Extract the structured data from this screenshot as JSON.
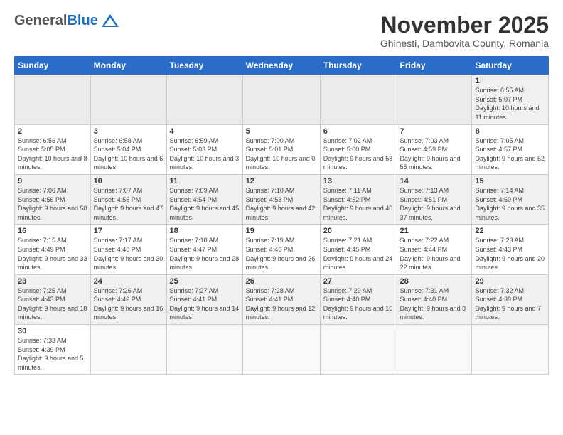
{
  "logo": {
    "general": "General",
    "blue": "Blue",
    "tagline": ""
  },
  "title": "November 2025",
  "subtitle": "Ghinesti, Dambovita County, Romania",
  "headers": [
    "Sunday",
    "Monday",
    "Tuesday",
    "Wednesday",
    "Thursday",
    "Friday",
    "Saturday"
  ],
  "weeks": [
    [
      {
        "day": "",
        "info": ""
      },
      {
        "day": "",
        "info": ""
      },
      {
        "day": "",
        "info": ""
      },
      {
        "day": "",
        "info": ""
      },
      {
        "day": "",
        "info": ""
      },
      {
        "day": "",
        "info": ""
      },
      {
        "day": "1",
        "info": "Sunrise: 6:55 AM\nSunset: 5:07 PM\nDaylight: 10 hours\nand 11 minutes."
      }
    ],
    [
      {
        "day": "2",
        "info": "Sunrise: 6:56 AM\nSunset: 5:05 PM\nDaylight: 10 hours\nand 8 minutes."
      },
      {
        "day": "3",
        "info": "Sunrise: 6:58 AM\nSunset: 5:04 PM\nDaylight: 10 hours\nand 6 minutes."
      },
      {
        "day": "4",
        "info": "Sunrise: 6:59 AM\nSunset: 5:03 PM\nDaylight: 10 hours\nand 3 minutes."
      },
      {
        "day": "5",
        "info": "Sunrise: 7:00 AM\nSunset: 5:01 PM\nDaylight: 10 hours\nand 0 minutes."
      },
      {
        "day": "6",
        "info": "Sunrise: 7:02 AM\nSunset: 5:00 PM\nDaylight: 9 hours\nand 58 minutes."
      },
      {
        "day": "7",
        "info": "Sunrise: 7:03 AM\nSunset: 4:59 PM\nDaylight: 9 hours\nand 55 minutes."
      },
      {
        "day": "8",
        "info": "Sunrise: 7:05 AM\nSunset: 4:57 PM\nDaylight: 9 hours\nand 52 minutes."
      }
    ],
    [
      {
        "day": "9",
        "info": "Sunrise: 7:06 AM\nSunset: 4:56 PM\nDaylight: 9 hours\nand 50 minutes."
      },
      {
        "day": "10",
        "info": "Sunrise: 7:07 AM\nSunset: 4:55 PM\nDaylight: 9 hours\nand 47 minutes."
      },
      {
        "day": "11",
        "info": "Sunrise: 7:09 AM\nSunset: 4:54 PM\nDaylight: 9 hours\nand 45 minutes."
      },
      {
        "day": "12",
        "info": "Sunrise: 7:10 AM\nSunset: 4:53 PM\nDaylight: 9 hours\nand 42 minutes."
      },
      {
        "day": "13",
        "info": "Sunrise: 7:11 AM\nSunset: 4:52 PM\nDaylight: 9 hours\nand 40 minutes."
      },
      {
        "day": "14",
        "info": "Sunrise: 7:13 AM\nSunset: 4:51 PM\nDaylight: 9 hours\nand 37 minutes."
      },
      {
        "day": "15",
        "info": "Sunrise: 7:14 AM\nSunset: 4:50 PM\nDaylight: 9 hours\nand 35 minutes."
      }
    ],
    [
      {
        "day": "16",
        "info": "Sunrise: 7:15 AM\nSunset: 4:49 PM\nDaylight: 9 hours\nand 33 minutes."
      },
      {
        "day": "17",
        "info": "Sunrise: 7:17 AM\nSunset: 4:48 PM\nDaylight: 9 hours\nand 30 minutes."
      },
      {
        "day": "18",
        "info": "Sunrise: 7:18 AM\nSunset: 4:47 PM\nDaylight: 9 hours\nand 28 minutes."
      },
      {
        "day": "19",
        "info": "Sunrise: 7:19 AM\nSunset: 4:46 PM\nDaylight: 9 hours\nand 26 minutes."
      },
      {
        "day": "20",
        "info": "Sunrise: 7:21 AM\nSunset: 4:45 PM\nDaylight: 9 hours\nand 24 minutes."
      },
      {
        "day": "21",
        "info": "Sunrise: 7:22 AM\nSunset: 4:44 PM\nDaylight: 9 hours\nand 22 minutes."
      },
      {
        "day": "22",
        "info": "Sunrise: 7:23 AM\nSunset: 4:43 PM\nDaylight: 9 hours\nand 20 minutes."
      }
    ],
    [
      {
        "day": "23",
        "info": "Sunrise: 7:25 AM\nSunset: 4:43 PM\nDaylight: 9 hours\nand 18 minutes."
      },
      {
        "day": "24",
        "info": "Sunrise: 7:26 AM\nSunset: 4:42 PM\nDaylight: 9 hours\nand 16 minutes."
      },
      {
        "day": "25",
        "info": "Sunrise: 7:27 AM\nSunset: 4:41 PM\nDaylight: 9 hours\nand 14 minutes."
      },
      {
        "day": "26",
        "info": "Sunrise: 7:28 AM\nSunset: 4:41 PM\nDaylight: 9 hours\nand 12 minutes."
      },
      {
        "day": "27",
        "info": "Sunrise: 7:29 AM\nSunset: 4:40 PM\nDaylight: 9 hours\nand 10 minutes."
      },
      {
        "day": "28",
        "info": "Sunrise: 7:31 AM\nSunset: 4:40 PM\nDaylight: 9 hours\nand 8 minutes."
      },
      {
        "day": "29",
        "info": "Sunrise: 7:32 AM\nSunset: 4:39 PM\nDaylight: 9 hours\nand 7 minutes."
      }
    ],
    [
      {
        "day": "30",
        "info": "Sunrise: 7:33 AM\nSunset: 4:39 PM\nDaylight: 9 hours\nand 5 minutes."
      },
      {
        "day": "",
        "info": ""
      },
      {
        "day": "",
        "info": ""
      },
      {
        "day": "",
        "info": ""
      },
      {
        "day": "",
        "info": ""
      },
      {
        "day": "",
        "info": ""
      },
      {
        "day": "",
        "info": ""
      }
    ]
  ]
}
